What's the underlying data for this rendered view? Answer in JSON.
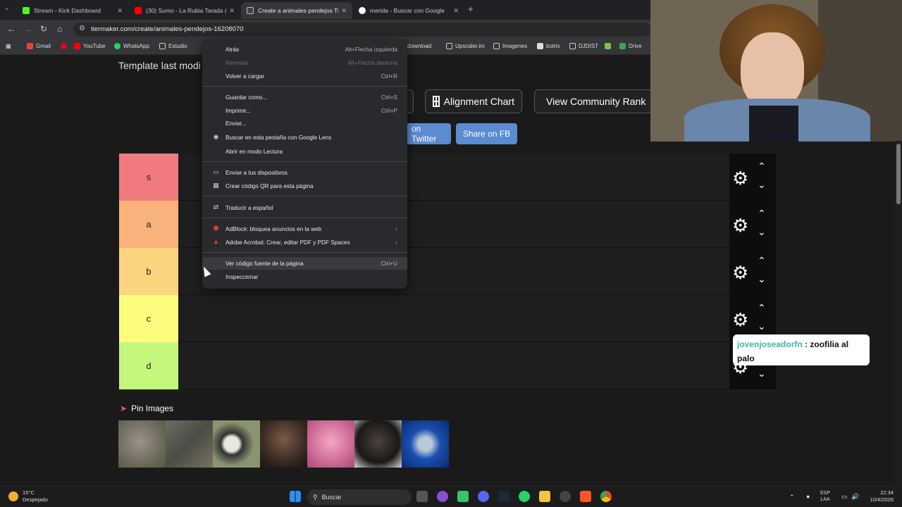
{
  "browser": {
    "tabs": [
      {
        "label": "Stream - Kick Dashboard",
        "icon_color": "#53fc18"
      },
      {
        "label": "(30) Sumo - La Rubia Tarada (O",
        "icon_color": "#ff0000"
      },
      {
        "label": "Create a animales pendejos Ti",
        "icon_color": "#ffffff"
      },
      {
        "label": "merida - Buscar con Google",
        "icon_color": "#4285f4"
      }
    ],
    "url": "tiermaker.com/create/animales-pendejos-16208070",
    "bookmarks": [
      "Gmail",
      "YouTube",
      "WhatsApp",
      "Estudio",
      "download",
      "Upscaler.im",
      "Imagenes",
      "botrix",
      "DJDIST",
      "Drive"
    ]
  },
  "page": {
    "template_text": "Template last modi",
    "buttons": {
      "alignment_chart": "Alignment Chart",
      "community_rank": "View Community Rank",
      "twitter": "on Twitter",
      "fb": "Share on FB"
    },
    "tiers": [
      {
        "label": "s",
        "color": "#f17a7e"
      },
      {
        "label": "a",
        "color": "#f9b27c"
      },
      {
        "label": "b",
        "color": "#fbd47f"
      },
      {
        "label": "c",
        "color": "#fbfc7e"
      },
      {
        "label": "d",
        "color": "#c6f77d"
      }
    ],
    "pin_title": "Pin Images",
    "pin_image_colors": [
      "#7f7a6a",
      "#5a5a4f",
      "#8a9070",
      "#4a3a30",
      "#d07a9a",
      "#2a2826",
      "#1a4aa0"
    ]
  },
  "context_menu": {
    "items": [
      {
        "label": "Atrás",
        "shortcut": "Alt+Flecha izquierda",
        "disabled": false,
        "icon": ""
      },
      {
        "label": "Reenviar",
        "shortcut": "Alt+Flecha derecha",
        "disabled": true,
        "icon": ""
      },
      {
        "label": "Volver a cargar",
        "shortcut": "Ctrl+R",
        "disabled": false,
        "icon": ""
      },
      {
        "label": "Guardar como...",
        "shortcut": "Ctrl+S",
        "disabled": false,
        "icon": ""
      },
      {
        "label": "Imprimir...",
        "shortcut": "Ctrl+P",
        "disabled": false,
        "icon": ""
      },
      {
        "label": "Enviar...",
        "shortcut": "",
        "disabled": false,
        "icon": ""
      },
      {
        "label": "Buscar en esta pestaña con Google Lens",
        "shortcut": "",
        "disabled": false,
        "icon": "lens-icon"
      },
      {
        "label": "Abrir en modo Lectura",
        "shortcut": "",
        "disabled": false,
        "icon": ""
      },
      {
        "label": "Enviar a tus dispositivos",
        "shortcut": "",
        "disabled": false,
        "icon": "devices-icon"
      },
      {
        "label": "Crear código QR para esta página",
        "shortcut": "",
        "disabled": false,
        "icon": "qr-icon"
      },
      {
        "label": "Traducir a español",
        "shortcut": "",
        "disabled": false,
        "icon": "translate-icon"
      },
      {
        "label": "AdBlock: bloquea anuncios en la web",
        "shortcut": "",
        "disabled": false,
        "icon": "adblock-icon"
      },
      {
        "label": "Adobe Acrobat: Crear, editar PDF y PDF Spaces",
        "shortcut": "",
        "disabled": false,
        "icon": "acrobat-icon"
      },
      {
        "label": "Ver código fuente de la página",
        "shortcut": "Ctrl+U",
        "disabled": false,
        "icon": ""
      },
      {
        "label": "Inspeccionar",
        "shortcut": "",
        "disabled": false,
        "icon": ""
      }
    ]
  },
  "chat": {
    "user": "jovenjoseadorfn",
    "separator": " : ",
    "message": "zoofilia al palo"
  },
  "taskbar": {
    "weather_temp": "15°C",
    "weather_desc": "Despejado",
    "search_label": "Buscar",
    "lang_top": "ESP",
    "lang_bottom": "LAA",
    "time": "22:34",
    "date": "10/4/2026"
  }
}
